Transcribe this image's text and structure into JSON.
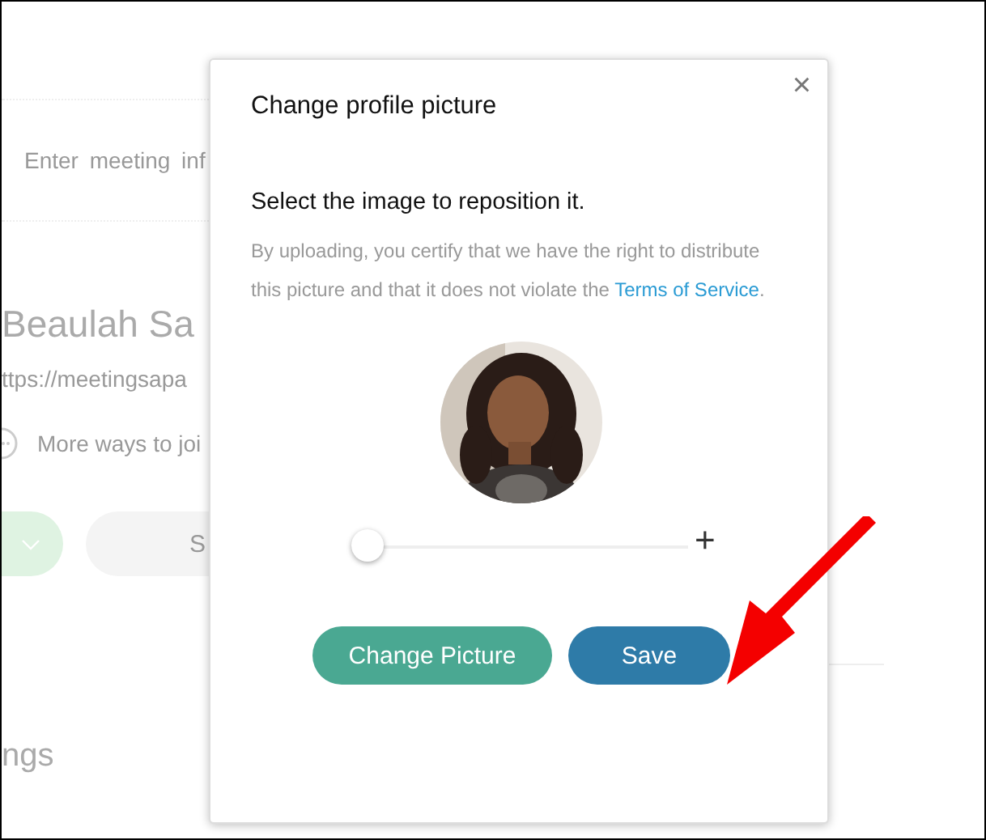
{
  "background": {
    "search": {
      "placeholder": "Enter meeting inf"
    },
    "name": "Beaulah Sa",
    "link": "ttps://meetingsapa",
    "more_ways": "More ways to joi",
    "start_button": "S",
    "section_title": "ngs"
  },
  "dialog": {
    "title": "Change profile picture",
    "close": "×",
    "heading": "Select the image to reposition it.",
    "notice": "By uploading, you certify that we have the right to distribute this picture and that it does not violate the ",
    "terms_link": "Terms of Service",
    "notice_end": ".",
    "zoom": {
      "level": 0,
      "plus": "+"
    },
    "buttons": [
      {
        "label": "Change Picture",
        "kind": "secondary"
      },
      {
        "label": "Save",
        "kind": "primary"
      }
    ]
  }
}
